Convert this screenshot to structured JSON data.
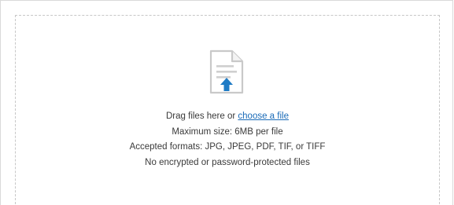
{
  "upload": {
    "prompt_prefix": "Drag files here or ",
    "choose_link": "choose a file",
    "max_size": "Maximum size: 6MB per file",
    "formats": "Accepted formats: JPG, JPEG, PDF, TIF, or TIFF",
    "restriction": "No encrypted or password-protected files",
    "icon": "file-upload-icon"
  },
  "colors": {
    "link": "#1a6bb8",
    "icon_accent": "#1f7bc5",
    "icon_outline": "#c9c9c9",
    "text": "#3a3a3a",
    "dashed_border": "#c7c7c7"
  }
}
